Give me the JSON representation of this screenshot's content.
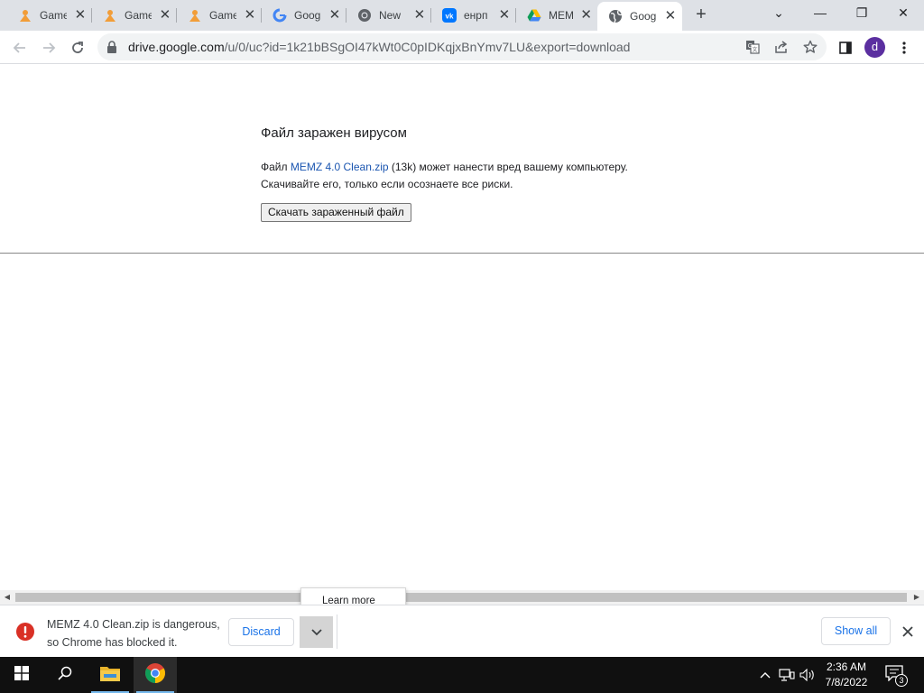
{
  "browser": {
    "tabs": [
      {
        "title": "Game",
        "favicon": "game-icon"
      },
      {
        "title": "Game",
        "favicon": "game-icon"
      },
      {
        "title": "Game",
        "favicon": "game-icon"
      },
      {
        "title": "Goog",
        "favicon": "google-icon"
      },
      {
        "title": "New",
        "favicon": "chrome-icon"
      },
      {
        "title": "енрп",
        "favicon": "vk-icon"
      },
      {
        "title": "MEM",
        "favicon": "drive-icon"
      },
      {
        "title": "Goog",
        "favicon": "globe-icon",
        "active": true
      }
    ],
    "tab_close_glyph": "✕",
    "new_tab_glyph": "+",
    "window_controls": {
      "tab_search": "⌄",
      "minimize": "—",
      "restore": "❐",
      "close": "✕"
    },
    "url": {
      "host": "drive.google.com",
      "path": "/u/0/uc?id=1k21bBSgOI47kWt0C0pIDKqjxBnYmv7LU&export=download"
    },
    "profile_initial": "d",
    "accent_color": "#1a73e8"
  },
  "page": {
    "heading": "Файл заражен вирусом",
    "line1_prefix": "Файл ",
    "file_link": "MEMZ 4.0 Clean.zip",
    "line1_suffix": " (13k) может нанести вред вашему компьютеру.",
    "line2": "Скачивайте его, только если осознаете все риски.",
    "download_button": "Скачать зараженный файл"
  },
  "popup": {
    "learn_more": "Learn more"
  },
  "download_shelf": {
    "line1": "MEMZ 4.0 Clean.zip is dangerous,",
    "line2": "so Chrome has blocked it.",
    "discard": "Discard",
    "show_all": "Show all",
    "warning_color": "#d93025"
  },
  "taskbar": {
    "time": "2:36 AM",
    "date": "7/8/2022",
    "notifications": "3"
  }
}
